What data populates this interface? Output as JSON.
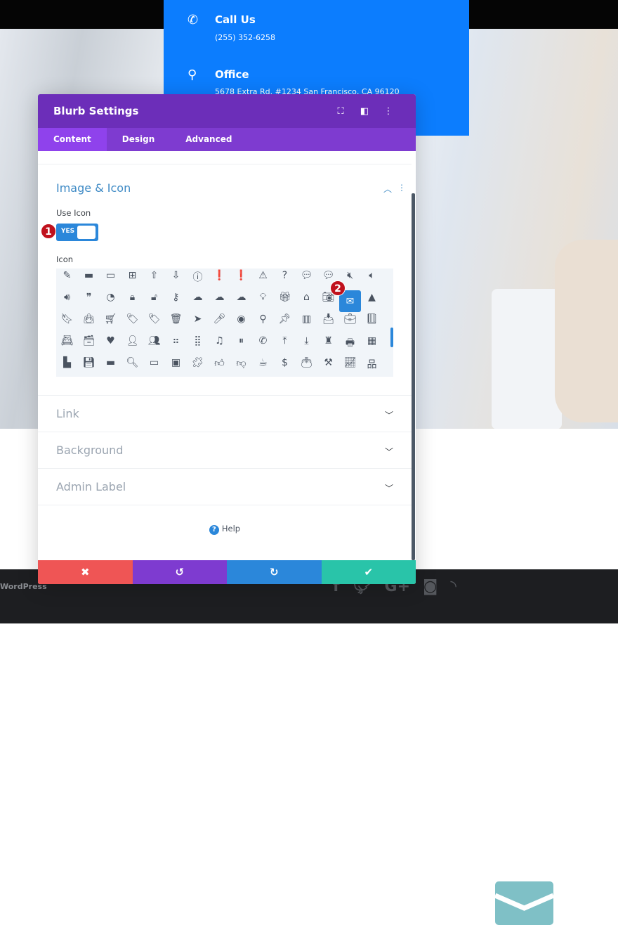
{
  "background": {
    "contact": [
      {
        "icon": "phone-icon",
        "title": "Call Us",
        "detail": "(255) 352-6258"
      },
      {
        "icon": "map-pin-icon",
        "title": "Office",
        "detail": "5678 Extra Rd. #1234 San Francisco, CA 96120"
      }
    ],
    "footer_text": "WordPress",
    "social": [
      "facebook-icon",
      "twitter-icon",
      "google-plus-icon",
      "instagram-icon",
      "rss-icon"
    ],
    "blurb_icon": "envelope-icon",
    "blurb_icon_color": "#7fc0c6",
    "accent_blue": "#0c7dfe"
  },
  "panel": {
    "title": "Blurb Settings",
    "header_icons": [
      "fullscreen-icon",
      "split-view-icon",
      "more-icon"
    ],
    "tabs": [
      {
        "label": "Content",
        "active": true
      },
      {
        "label": "Design",
        "active": false
      },
      {
        "label": "Advanced",
        "active": false
      }
    ],
    "section_open": "Image & Icon",
    "use_icon_label": "Use Icon",
    "use_icon_value": "YES",
    "icon_label": "Icon",
    "selected_icon": "envelope",
    "icons": [
      "pencil",
      "folder",
      "folder-open",
      "folder-add",
      "folder-upload",
      "folder-download",
      "info",
      "exclamation-circle",
      "exclamation",
      "warning",
      "question",
      "comment",
      "comments",
      "volume-mute",
      "volume-low",
      "volume-high",
      "quote",
      "clock",
      "lock",
      "unlock",
      "key",
      "cloud",
      "cloud-upload",
      "cloud-download",
      "lightbulb",
      "gift",
      "home",
      "camera",
      "envelope",
      "cone",
      "bookmark",
      "shopping-bag",
      "cart",
      "tag",
      "tags",
      "trash",
      "cursor",
      "microphone",
      "compass",
      "map-pin",
      "pushpin",
      "map",
      "inbox",
      "briefcase",
      "book",
      "address-book",
      "archive",
      "heart",
      "user",
      "users",
      "grid-small",
      "grid",
      "music",
      "pause",
      "phone",
      "upload",
      "download",
      "chess-rook",
      "printer",
      "calculator",
      "building",
      "floppy",
      "drive",
      "document-search",
      "id-card",
      "badge-id",
      "puzzle",
      "thumbs-up",
      "thumbs-down",
      "cup",
      "dollar",
      "wallet",
      "tools",
      "presentation",
      "sitemap"
    ],
    "sections": [
      "Link",
      "Background",
      "Admin Label"
    ],
    "help_label": "Help",
    "step_badges": [
      "1",
      "2"
    ],
    "actions": [
      {
        "name": "cancel",
        "glyph": "✖",
        "color": "#ef5555"
      },
      {
        "name": "undo",
        "glyph": "↺",
        "color": "#7e3bd0"
      },
      {
        "name": "redo",
        "glyph": "↻",
        "color": "#2b87da"
      },
      {
        "name": "save",
        "glyph": "✔",
        "color": "#29c4a9"
      }
    ]
  }
}
